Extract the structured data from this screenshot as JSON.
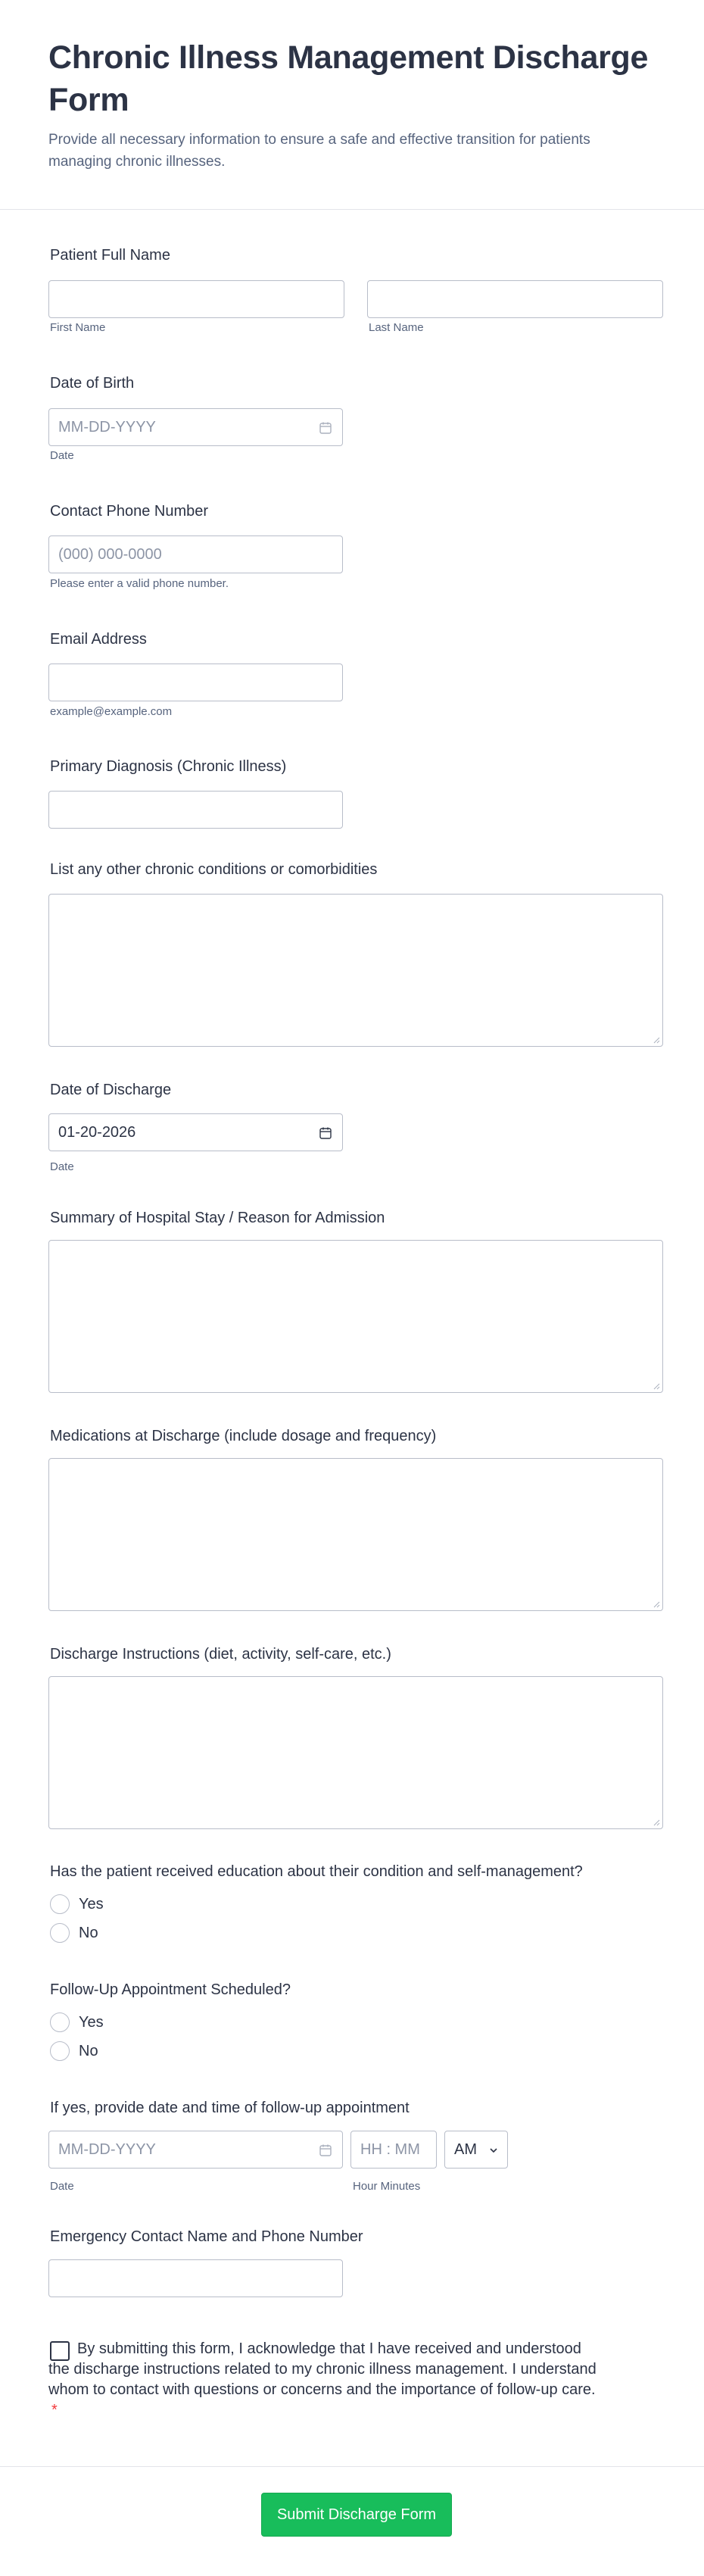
{
  "form": {
    "title": "Chronic Illness Management Discharge Form",
    "subtitle": "Provide all necessary information to ensure a safe and effective transition for patients managing chronic illnesses."
  },
  "patient_name": {
    "label": "Patient Full Name",
    "first_sub": "First Name",
    "last_sub": "Last Name",
    "first_value": "",
    "last_value": ""
  },
  "dob": {
    "label": "Date of Birth",
    "placeholder": "MM-DD-YYYY",
    "sub": "Date"
  },
  "phone": {
    "label": "Contact Phone Number",
    "placeholder": "(000) 000-0000",
    "sub": "Please enter a valid phone number."
  },
  "email": {
    "label": "Email Address",
    "sub": "example@example.com",
    "value": ""
  },
  "primary_diagnosis": {
    "label": "Primary Diagnosis (Chronic Illness)",
    "value": ""
  },
  "comorbidities": {
    "label": "List any other chronic conditions or comorbidities",
    "value": ""
  },
  "discharge_date": {
    "label": "Date of Discharge",
    "value": "01-20-2026",
    "sub": "Date"
  },
  "hospital_summary": {
    "label": "Summary of Hospital Stay / Reason for Admission",
    "value": ""
  },
  "medications": {
    "label": "Medications at Discharge (include dosage and frequency)",
    "value": ""
  },
  "instructions": {
    "label": "Discharge Instructions (diet, activity, self-care, etc.)",
    "value": ""
  },
  "education": {
    "label": "Has the patient received education about their condition and self-management?",
    "options": [
      "Yes",
      "No"
    ]
  },
  "followup_scheduled": {
    "label": "Follow-Up Appointment Scheduled?",
    "options": [
      "Yes",
      "No"
    ]
  },
  "followup_datetime": {
    "label": "If yes, provide date and time of follow-up appointment",
    "date_placeholder": "MM-DD-YYYY",
    "time_placeholder": "HH : MM",
    "ampm_value": "AM",
    "date_sub": "Date",
    "time_sub": "Hour Minutes"
  },
  "emergency_contact": {
    "label": "Emergency Contact Name and Phone Number",
    "value": ""
  },
  "acknowledgement": {
    "text": "By submitting this form, I acknowledge that I have received and understood the discharge instructions related to my chronic illness management. I understand whom to contact with questions or concerns and the importance of follow-up care.",
    "required_mark": "*"
  },
  "submit": {
    "label": "Submit Discharge Form"
  },
  "colors": {
    "accent": "#18bd5b",
    "required": "#f23a3c",
    "text": "#2c3345",
    "muted": "#57647e",
    "border": "#b8bdc9"
  }
}
